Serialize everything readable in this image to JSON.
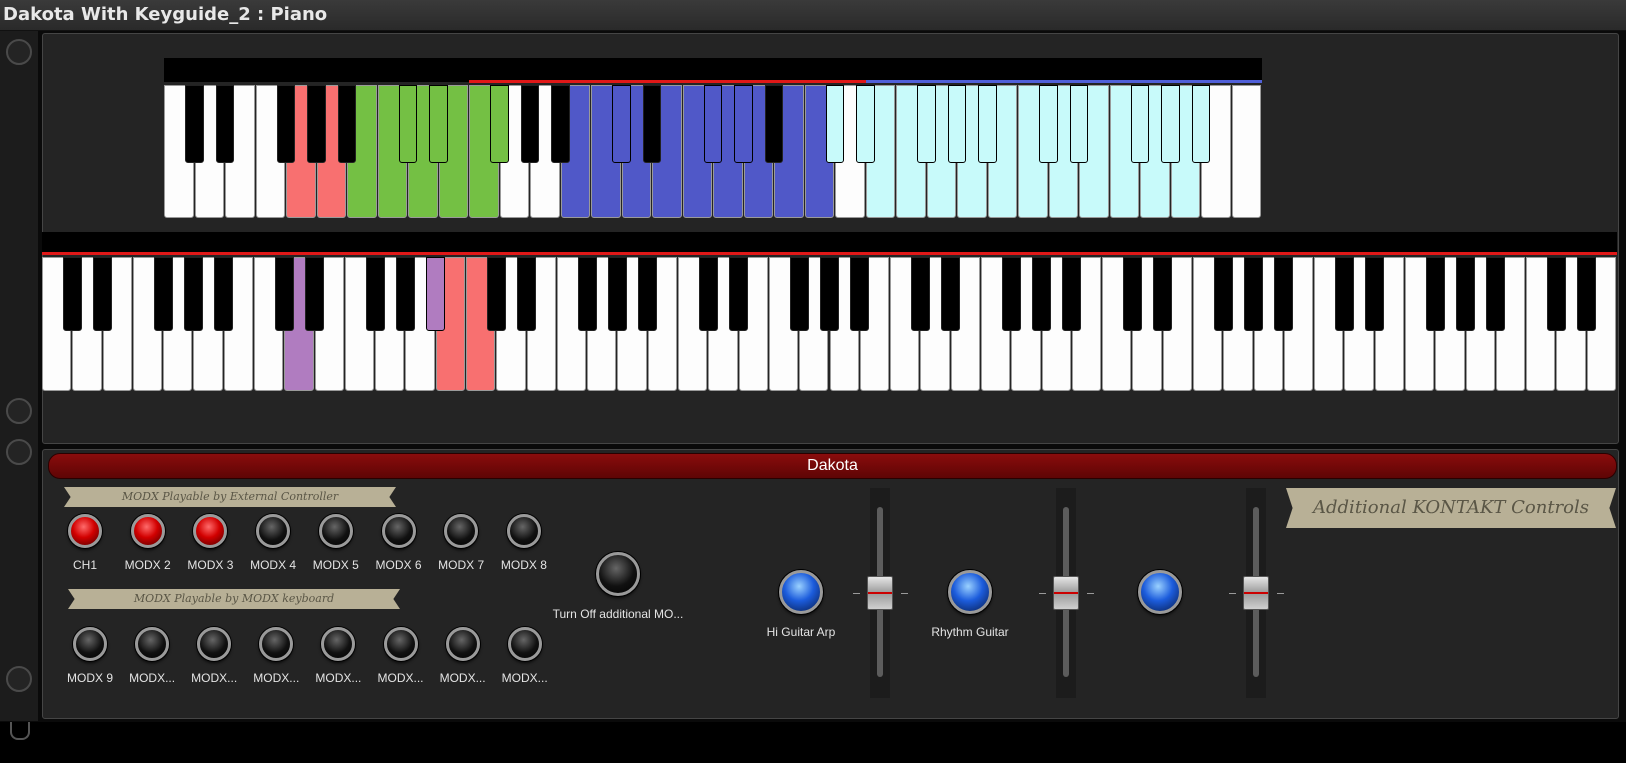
{
  "window": {
    "title": "Dakota With Keyguide_2 : Piano"
  },
  "colors": {
    "top_range_highlight": "#e01818",
    "top_range2_highlight": "#5060d8",
    "main_range_highlight": "#e01818",
    "banner": "#7a0a0a",
    "salmon": "#f87070",
    "green": "#74c044",
    "blue": "#5058c8",
    "cyan": "#c8fafa",
    "purple": "#b07cc0"
  },
  "keyboards": {
    "upper": {
      "white_keys": 36,
      "colored_white_keys": {
        "4": "salmon",
        "5": "salmon",
        "6": "green",
        "7": "green",
        "8": "green",
        "9": "green",
        "10": "green",
        "13": "blue",
        "14": "blue",
        "15": "blue",
        "16": "blue",
        "17": "blue",
        "18": "blue",
        "19": "blue",
        "20": "blue",
        "21": "blue",
        "23": "cyan",
        "24": "cyan",
        "25": "cyan",
        "26": "cyan",
        "27": "cyan",
        "28": "cyan",
        "29": "cyan",
        "30": "cyan",
        "31": "cyan",
        "32": "cyan",
        "33": "cyan"
      },
      "black_key_colors": {
        "17": "green",
        "18": "green",
        "20": "green",
        "27": "blue",
        "30": "blue",
        "32": "blue",
        "34": "blue",
        "36": "blue",
        "39": "cyan",
        "42": "cyan",
        "44": "cyan",
        "46": "cyan",
        "49": "cyan",
        "51": "cyan",
        "54": "cyan",
        "56": "cyan",
        "58": "cyan"
      }
    },
    "lower": {
      "white_keys": 52,
      "colored_white_keys": {
        "8": "purple",
        "13": "salmon",
        "14": "salmon"
      },
      "black_key_colors": {
        "11": "purple",
        "15": "purple"
      }
    }
  },
  "section": {
    "banner": "Dakota"
  },
  "tags": {
    "external": "MODX Playable by External Controller",
    "keyboard": "MODX Playable by MODX keyboard",
    "additional": "Additional KONTAKT Controls"
  },
  "row1": [
    {
      "label": "CH1",
      "state": "red"
    },
    {
      "label": "MODX 2",
      "state": "red"
    },
    {
      "label": "MODX 3",
      "state": "red"
    },
    {
      "label": "MODX 4",
      "state": "off"
    },
    {
      "label": "MODX 5",
      "state": "off"
    },
    {
      "label": "MODX 6",
      "state": "off"
    },
    {
      "label": "MODX 7",
      "state": "off"
    },
    {
      "label": "MODX 8",
      "state": "off"
    }
  ],
  "row2": [
    {
      "label": "MODX 9"
    },
    {
      "label": "MODX..."
    },
    {
      "label": "MODX..."
    },
    {
      "label": "MODX..."
    },
    {
      "label": "MODX..."
    },
    {
      "label": "MODX..."
    },
    {
      "label": "MODX..."
    },
    {
      "label": "MODX..."
    }
  ],
  "turn_off": {
    "label": "Turn Off additional MO..."
  },
  "kontakt": [
    {
      "label": "Hi Guitar Arp"
    },
    {
      "label": "Rhythm Guitar"
    },
    {
      "label": ""
    }
  ]
}
